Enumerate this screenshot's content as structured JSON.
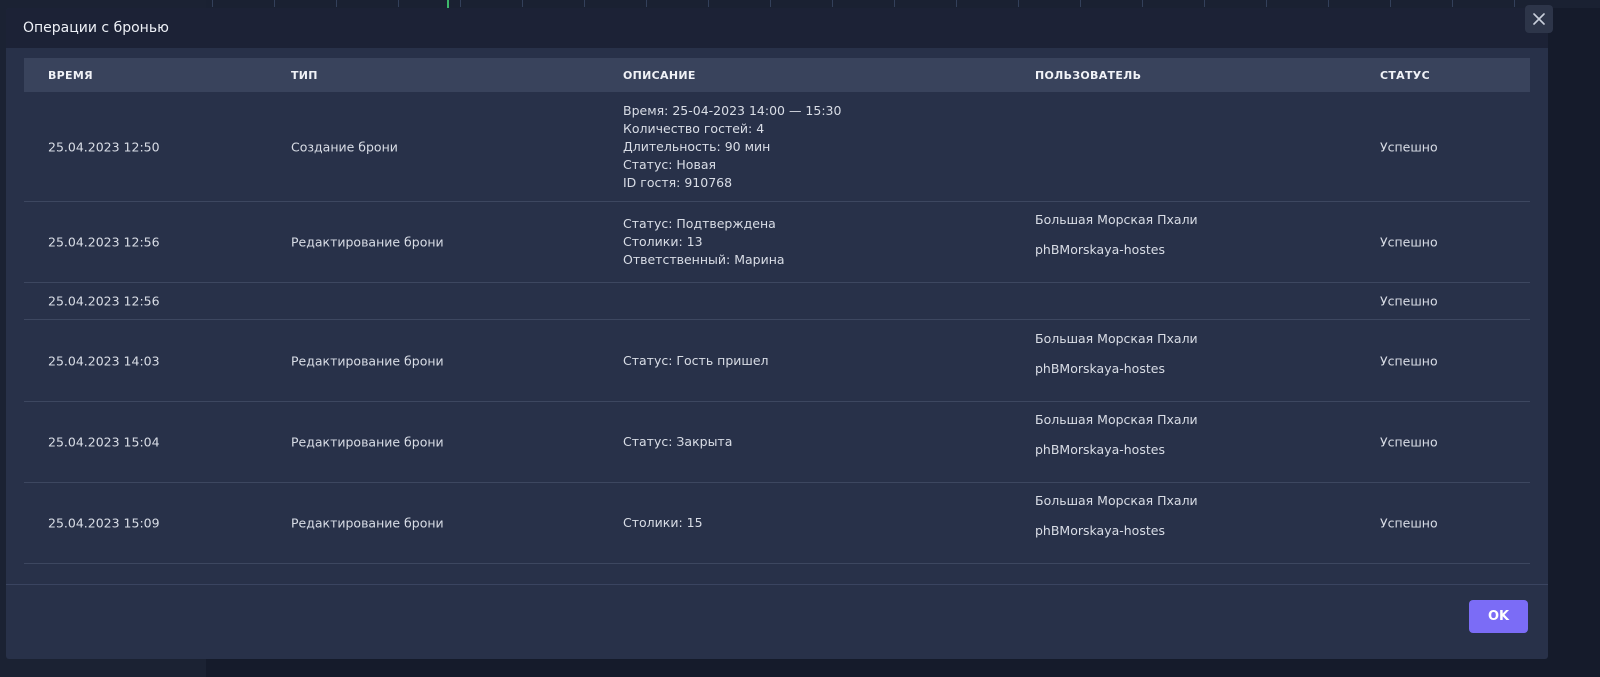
{
  "modal": {
    "title": "Операции с бронью",
    "ok_label": "OK"
  },
  "table": {
    "headers": {
      "time": "ВРЕМЯ",
      "type": "ТИП",
      "description": "ОПИСАНИЕ",
      "user": "ПОЛЬЗОВАТЕЛЬ",
      "status": "СТАТУС"
    },
    "rows": [
      {
        "time": "25.04.2023 12:50",
        "type": "Создание брони",
        "description": [
          "Время: 25-04-2023 14:00 — 15:30",
          "Количество гостей: 4",
          "Длительность: 90 мин",
          "Статус: Новая",
          "ID гостя: 910768"
        ],
        "user_name": "",
        "user_login": "",
        "status": "Успешно"
      },
      {
        "time": "25.04.2023 12:56",
        "type": "Редактирование брони",
        "description": [
          "Статус: Подтверждена",
          "Столики: 13",
          "Ответственный: Марина"
        ],
        "user_name": "Большая Морская Пхали",
        "user_login": "phBMorskaya-hostes",
        "status": "Успешно"
      },
      {
        "time": "25.04.2023 12:56",
        "type": "",
        "description": [],
        "user_name": "",
        "user_login": "",
        "status": "Успешно"
      },
      {
        "time": "25.04.2023 14:03",
        "type": "Редактирование брони",
        "description": [
          "Статус: Гость пришел"
        ],
        "user_name": "Большая Морская Пхали",
        "user_login": "phBMorskaya-hostes",
        "status": "Успешно"
      },
      {
        "time": "25.04.2023 15:04",
        "type": "Редактирование брони",
        "description": [
          "Статус: Закрыта"
        ],
        "user_name": "Большая Морская Пхали",
        "user_login": "phBMorskaya-hostes",
        "status": "Успешно"
      },
      {
        "time": "25.04.2023 15:09",
        "type": "Редактирование брони",
        "description": [
          "Столики: 15"
        ],
        "user_name": "Большая Морская Пхали",
        "user_login": "phBMorskaya-hostes",
        "status": "Успешно"
      }
    ]
  },
  "icons": {
    "close": "close-icon"
  },
  "colors": {
    "accent": "#7b6cf6",
    "modal_bg": "#283149",
    "header_bg": "#1c2236",
    "table_header_bg": "#39435c"
  }
}
